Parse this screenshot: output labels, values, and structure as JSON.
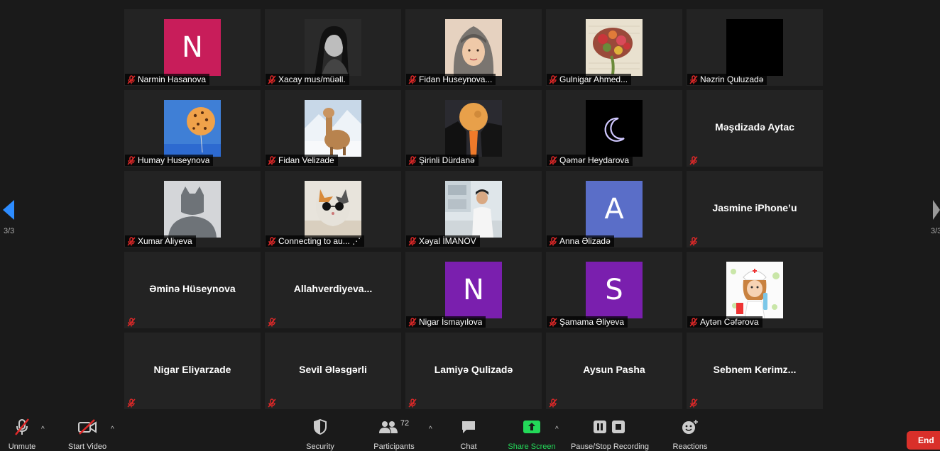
{
  "participants": [
    {
      "name": "Narmin Hasanova",
      "avatar": {
        "kind": "letter",
        "letter": "N",
        "color": "#c81d5a"
      }
    },
    {
      "name": "Xacay mus/müəll.",
      "avatar": {
        "kind": "photo",
        "theme": "portrait-bw"
      }
    },
    {
      "name": "Fidan Huseynova...",
      "avatar": {
        "kind": "photo",
        "theme": "portrait-scarf"
      }
    },
    {
      "name": "Gulnigar Ahmed...",
      "avatar": {
        "kind": "photo",
        "theme": "brain-flowers"
      }
    },
    {
      "name": "Nəzrin Quluzadə",
      "avatar": {
        "kind": "photo",
        "theme": "black"
      }
    },
    {
      "name": "Humay Huseynova",
      "avatar": {
        "kind": "photo",
        "theme": "balloon-sky"
      }
    },
    {
      "name": "Fidan Velizade",
      "avatar": {
        "kind": "photo",
        "theme": "alpaca-snow"
      }
    },
    {
      "name": "Şirinli Dürdanə",
      "avatar": {
        "kind": "photo",
        "theme": "moon-cliff"
      }
    },
    {
      "name": "Qəmər Heydarova",
      "avatar": {
        "kind": "photo",
        "theme": "crescent-moon"
      }
    },
    {
      "name": "Məşdizadə Aytac",
      "avatar": {
        "kind": "none"
      }
    },
    {
      "name": "Xumar Aliyeva",
      "avatar": {
        "kind": "photo",
        "theme": "default-cat"
      }
    },
    {
      "name": "Connecting to au... ⋰",
      "avatar": {
        "kind": "photo",
        "theme": "cat-glasses"
      }
    },
    {
      "name": "Xəyal İMANOV",
      "avatar": {
        "kind": "photo",
        "theme": "lab"
      }
    },
    {
      "name": "Anna Əlizadə",
      "avatar": {
        "kind": "letter",
        "letter": "A",
        "color": "#5a6ec8"
      }
    },
    {
      "name": "Jasmine iPhone’u",
      "avatar": {
        "kind": "none"
      }
    },
    {
      "name": "Əminə Hüseynova",
      "avatar": {
        "kind": "none"
      }
    },
    {
      "name": "Allahverdiyeva...",
      "avatar": {
        "kind": "none"
      }
    },
    {
      "name": "Nigar İsmayılova",
      "avatar": {
        "kind": "letter",
        "letter": "N",
        "color": "#7a1fae"
      }
    },
    {
      "name": "Şamama Əliyeva",
      "avatar": {
        "kind": "letter",
        "letter": "S",
        "color": "#7a1fae"
      }
    },
    {
      "name": "Aytən Cəfərova",
      "avatar": {
        "kind": "photo",
        "theme": "nurse-cartoon"
      }
    },
    {
      "name": "Nigar Eliyarzade",
      "avatar": {
        "kind": "none"
      }
    },
    {
      "name": "Sevil Ələsgərli",
      "avatar": {
        "kind": "none"
      }
    },
    {
      "name": "Lamiyə Qulizadə",
      "avatar": {
        "kind": "none"
      }
    },
    {
      "name": "Aysun Pasha",
      "avatar": {
        "kind": "none"
      }
    },
    {
      "name": "Sebnem  Kerimz...",
      "avatar": {
        "kind": "none"
      }
    }
  ],
  "pager": {
    "left": "3/3",
    "right": "3/3"
  },
  "toolbar": {
    "unmute": "Unmute",
    "start_video": "Start Video",
    "security": "Security",
    "participants": "Participants",
    "participants_count": "72",
    "chat": "Chat",
    "share_screen": "Share Screen",
    "record": "Pause/Stop Recording",
    "reactions": "Reactions",
    "end": "End"
  },
  "colors": {
    "share_green": "#23d959",
    "end_red": "#d9302a",
    "muted_red": "#e02828",
    "accent_blue": "#2d8cff"
  }
}
